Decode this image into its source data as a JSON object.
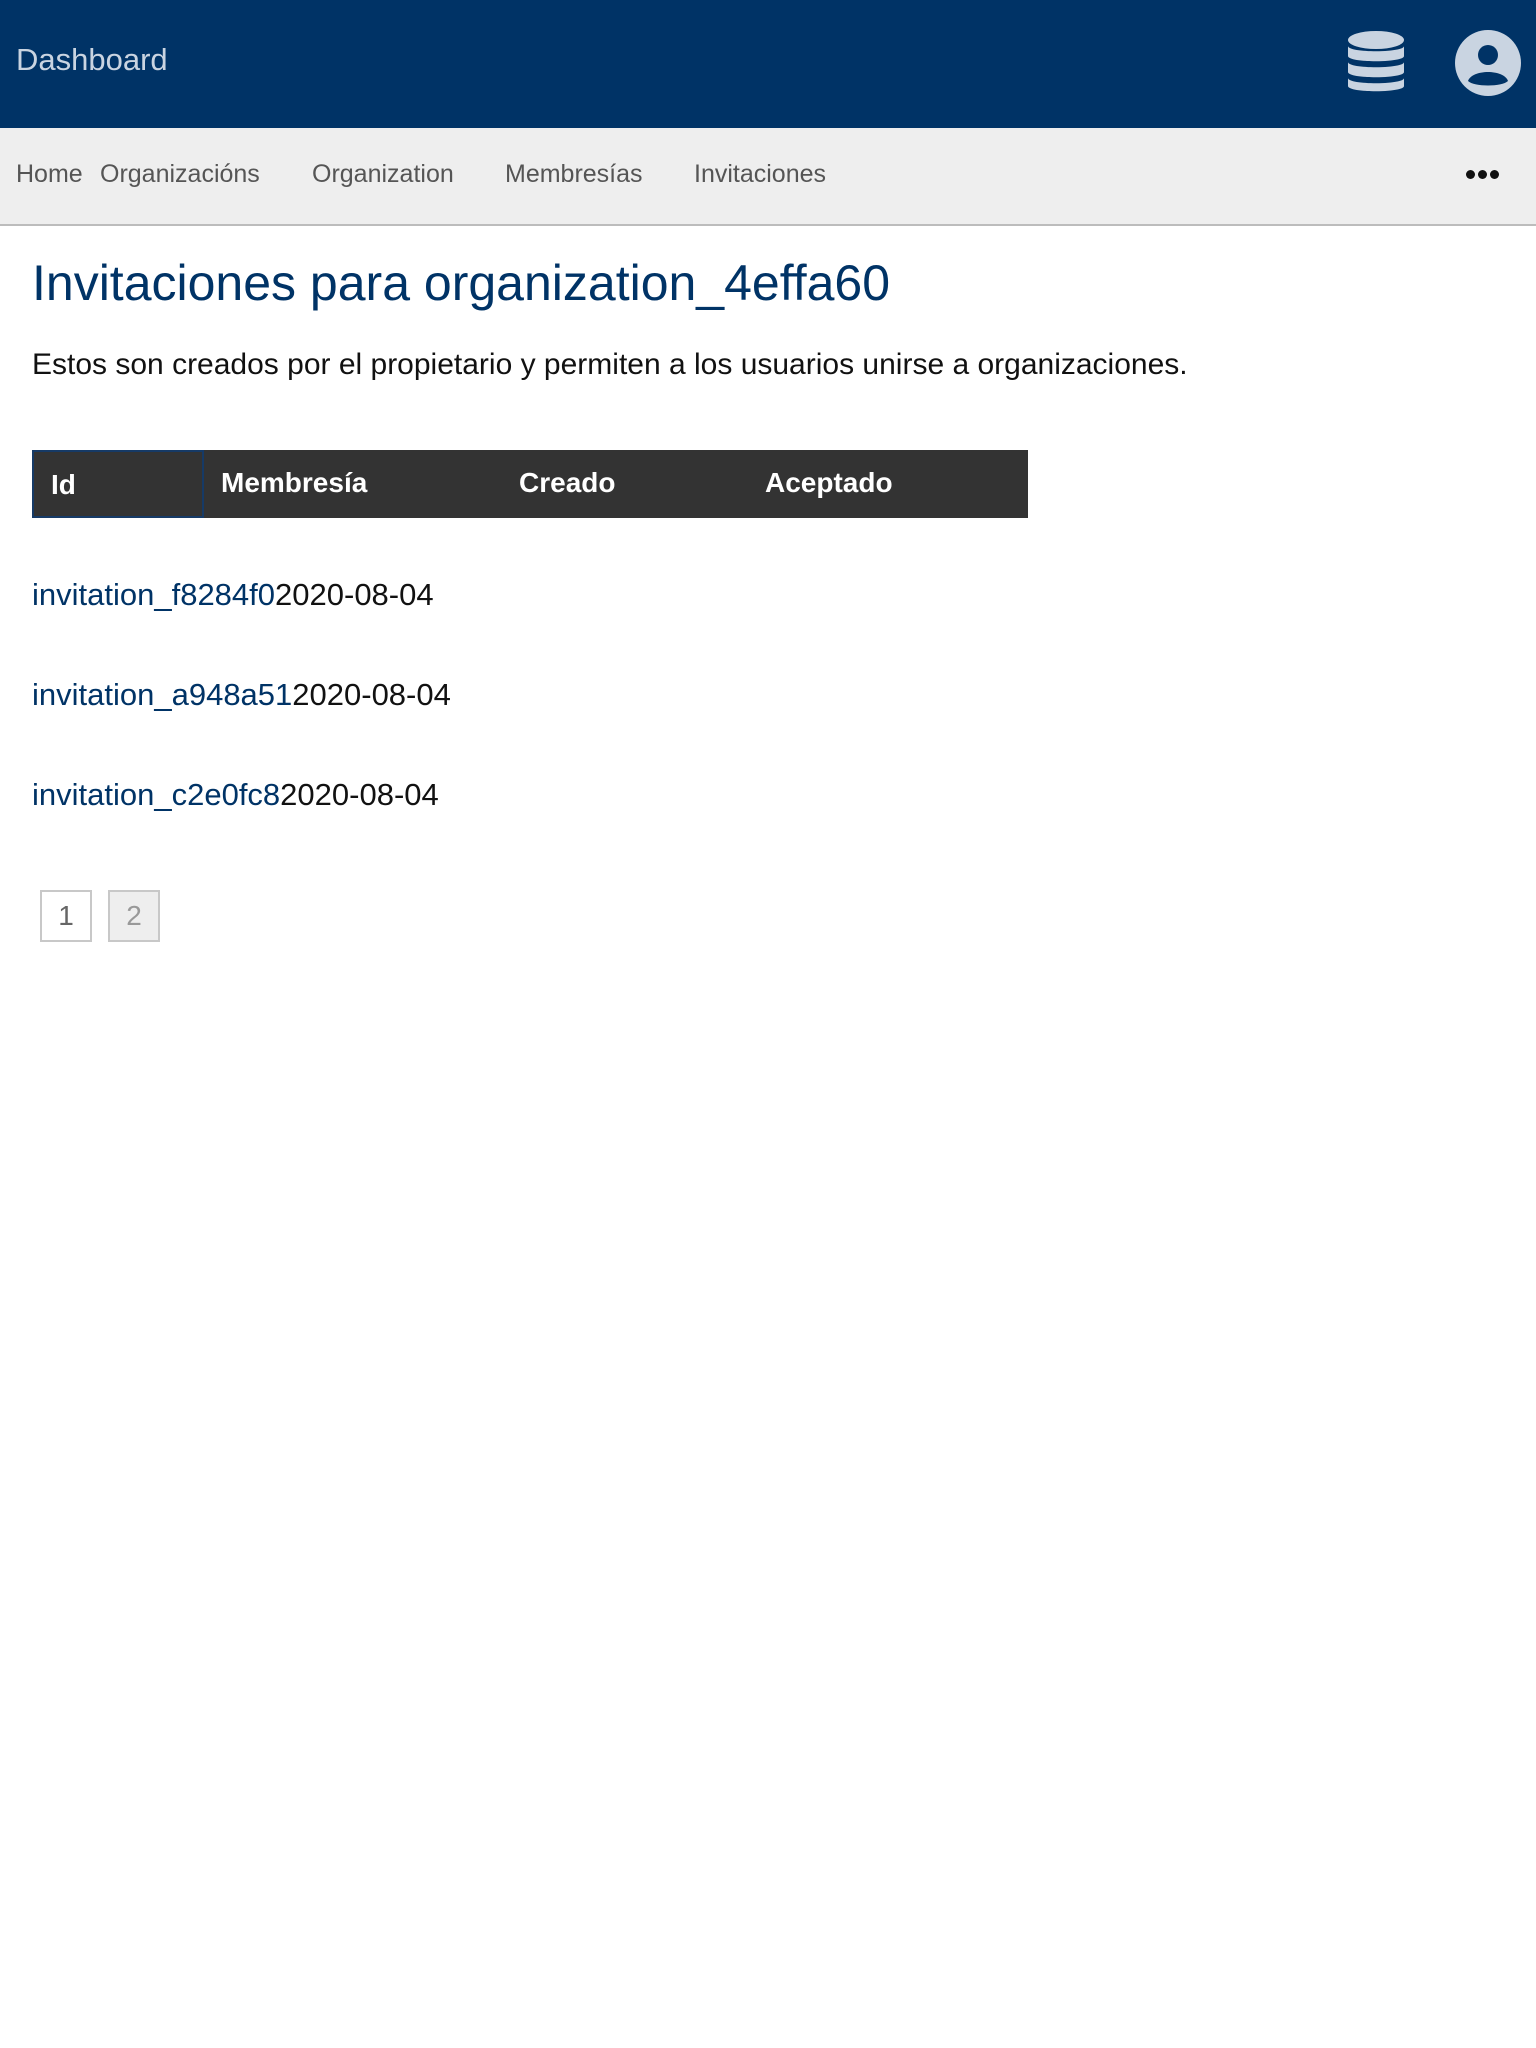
{
  "header": {
    "brand": "Dashboard",
    "icons": [
      "database-icon",
      "account-circle-icon"
    ],
    "colors": {
      "background": "#003366",
      "text": "#c9d4e1",
      "icon": "#c9d4e1"
    }
  },
  "nav": {
    "items": [
      {
        "label": "Home"
      },
      {
        "label": "Organizacións"
      },
      {
        "label": "Organization"
      },
      {
        "label": "Membresías"
      },
      {
        "label": "Invitaciones"
      }
    ],
    "more_icon": "more-horizontal-icon"
  },
  "main": {
    "title": "Invitaciones para organization_4effa60",
    "description": "Estos son creados por el propietario y permiten a los usuarios unirse a organizaciones."
  },
  "table": {
    "columns": [
      "Id",
      "Membresía",
      "Creado",
      "Aceptado"
    ],
    "rows": [
      {
        "id": "invitation_f8284f0",
        "created": "2020-08-04"
      },
      {
        "id": "invitation_a948a51",
        "created": "2020-08-04"
      },
      {
        "id": "invitation_c2e0fc8",
        "created": "2020-08-04"
      }
    ]
  },
  "pagination": {
    "pages": [
      "1",
      "2"
    ],
    "current": "2"
  }
}
